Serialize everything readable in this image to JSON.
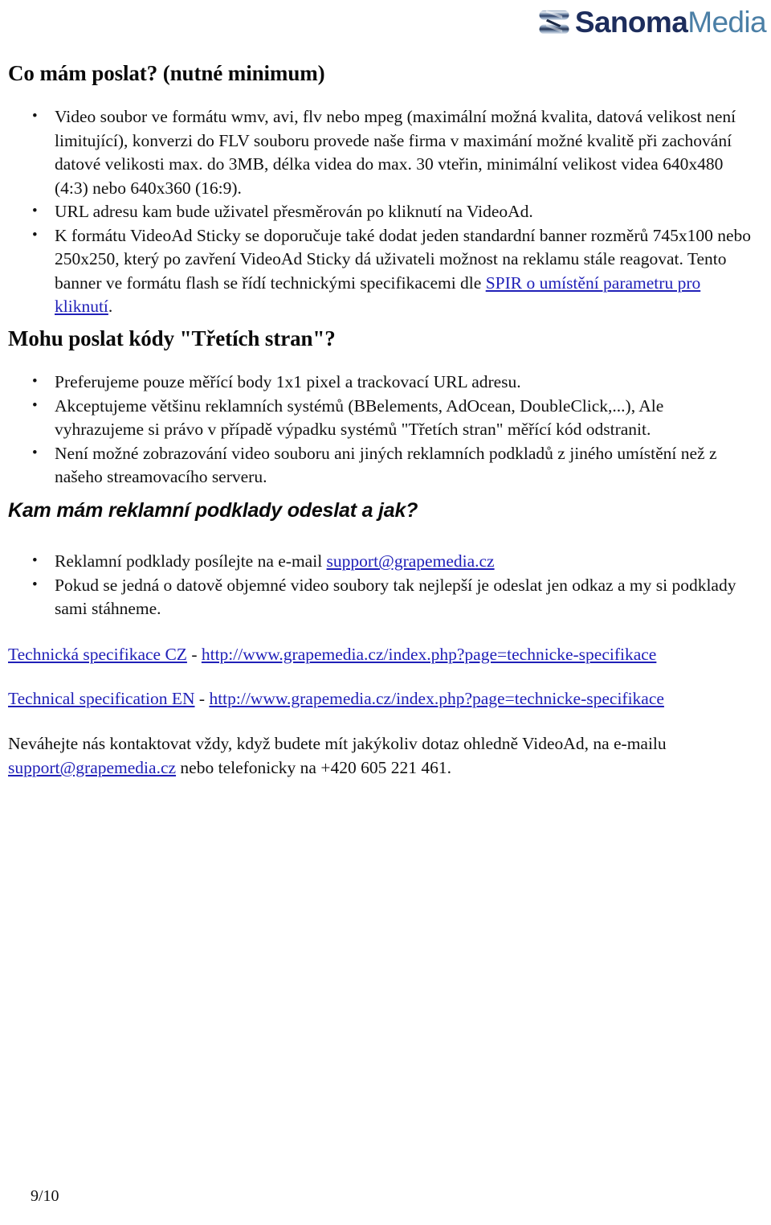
{
  "header": {
    "logo": {
      "icon": "sanoma-s-ribbon-icon",
      "primary_word": "Sanoma",
      "secondary_word": "Media",
      "primary_color": "#1d2d5c",
      "secondary_color": "#4b7fa6"
    }
  },
  "sections": [
    {
      "heading": "Co mám poslat? (nutné minimum)",
      "bullets": [
        "Video soubor ve formátu wmv, avi, flv nebo mpeg (maximální možná kvalita, datová velikost není limitující), konverzi do FLV souboru provede naše firma v maximání možné kvalitě při zachování datové velikosti max. do 3MB, délka videa do max. 30 vteřin, minimální velikost videa 640x480 (4:3) nebo 640x360 (16:9).",
        "URL adresu kam bude uživatel přesměrován po kliknutí na VideoAd."
      ],
      "bullet_with_link": {
        "before": "K formátu VideoAd Sticky se doporučuje také dodat jeden standardní banner rozměrů 745x100 nebo 250x250, který po zavření VideoAd Sticky dá uživateli možnost na reklamu stále reagovat. Tento banner ve formátu flash se řídí technickými specifikacemi dle ",
        "link_text": "SPIR o umístění parametru pro kliknutí",
        "after": "."
      }
    },
    {
      "heading": "Mohu poslat kódy \"Třetích stran\"?",
      "bullets": [
        "Preferujeme pouze měřící body 1x1 pixel a trackovací URL adresu.",
        "Akceptujeme většinu reklamních systémů (BBelements, AdOcean, DoubleClick,...), Ale vyhrazujeme si právo v případě výpadku systémů \"Třetích stran\" měřící kód odstranit.",
        "Není možné zobrazování video souboru ani jiných reklamních podkladů z jiného umístění než z našeho streamovacího serveru."
      ]
    },
    {
      "heading": "Kam mám reklamní podklady odeslat a jak?",
      "bullet_email": {
        "before": "Reklamní podklady posílejte na e-mail ",
        "link_text": "support@grapemedia.cz",
        "after": ""
      },
      "bullets": [
        "Pokud se jedná o datově objemné video soubory tak nejlepší je odeslat jen odkaz a my si podklady sami stáhneme."
      ]
    }
  ],
  "spec_links": [
    {
      "label": "Technická specifikace CZ",
      "separator": " - ",
      "url": "http://www.grapemedia.cz/index.php?page=technicke-specifikace"
    },
    {
      "label": "Technical specification EN",
      "separator": " - ",
      "url": "http://www.grapemedia.cz/index.php?page=technicke-specifikace"
    }
  ],
  "closing": {
    "line1": "Neváhejte nás kontaktovat vždy, když budete mít jakýkoliv dotaz ohledně VideoAd, na e-mailu",
    "email": "support@grapemedia.cz",
    "line2_after": " nebo telefonicky na +420 605 221 461."
  },
  "footer": {
    "page_number": "9/10"
  },
  "colors": {
    "link": "#2020b8",
    "text": "#111111"
  }
}
